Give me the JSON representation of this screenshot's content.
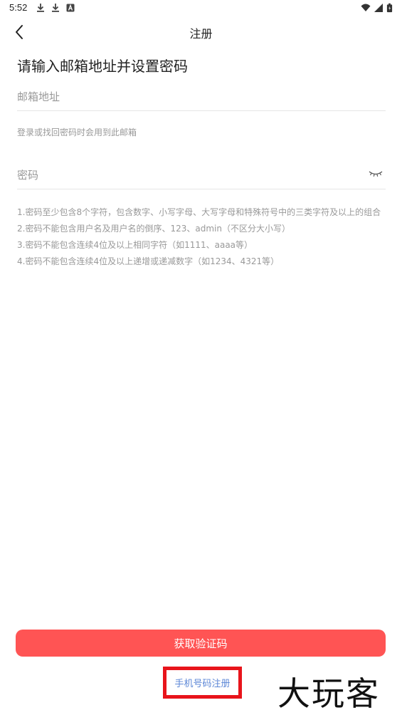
{
  "status_bar": {
    "time": "5:52",
    "left_icons": [
      "download-icon",
      "download-icon",
      "app-a-icon"
    ],
    "right_icons": [
      "wifi-icon",
      "signal-icon",
      "battery-icon"
    ]
  },
  "nav": {
    "title": "注册",
    "back_icon": "chevron-left-icon"
  },
  "form": {
    "heading": "请输入邮箱地址并设置密码",
    "email_placeholder": "邮箱地址",
    "email_hint": "登录或找回密码时会用到此邮箱",
    "password_placeholder": "密码",
    "password_toggle_icon": "eye-closed-icon"
  },
  "password_rules": [
    "1.密码至少包含8个字符，包含数字、小写字母、大写字母和特殊符号中的三类字符及以上的组合",
    "2.密码不能包含用户名及用户名的倒序、123、admin（不区分大小写）",
    "3.密码不能包含连续4位及以上相同字符（如1111、aaaa等）",
    "4.密码不能包含连续4位及以上递增或递减数字（如1234、4321等）"
  ],
  "actions": {
    "get_code_label": "获取验证码",
    "phone_register_label": "手机号码注册"
  },
  "watermark": "大玩客",
  "colors": {
    "primary": "#ff5454",
    "link": "#5b86d6",
    "highlight_box": "#e8141b",
    "hint_text": "#999999"
  }
}
